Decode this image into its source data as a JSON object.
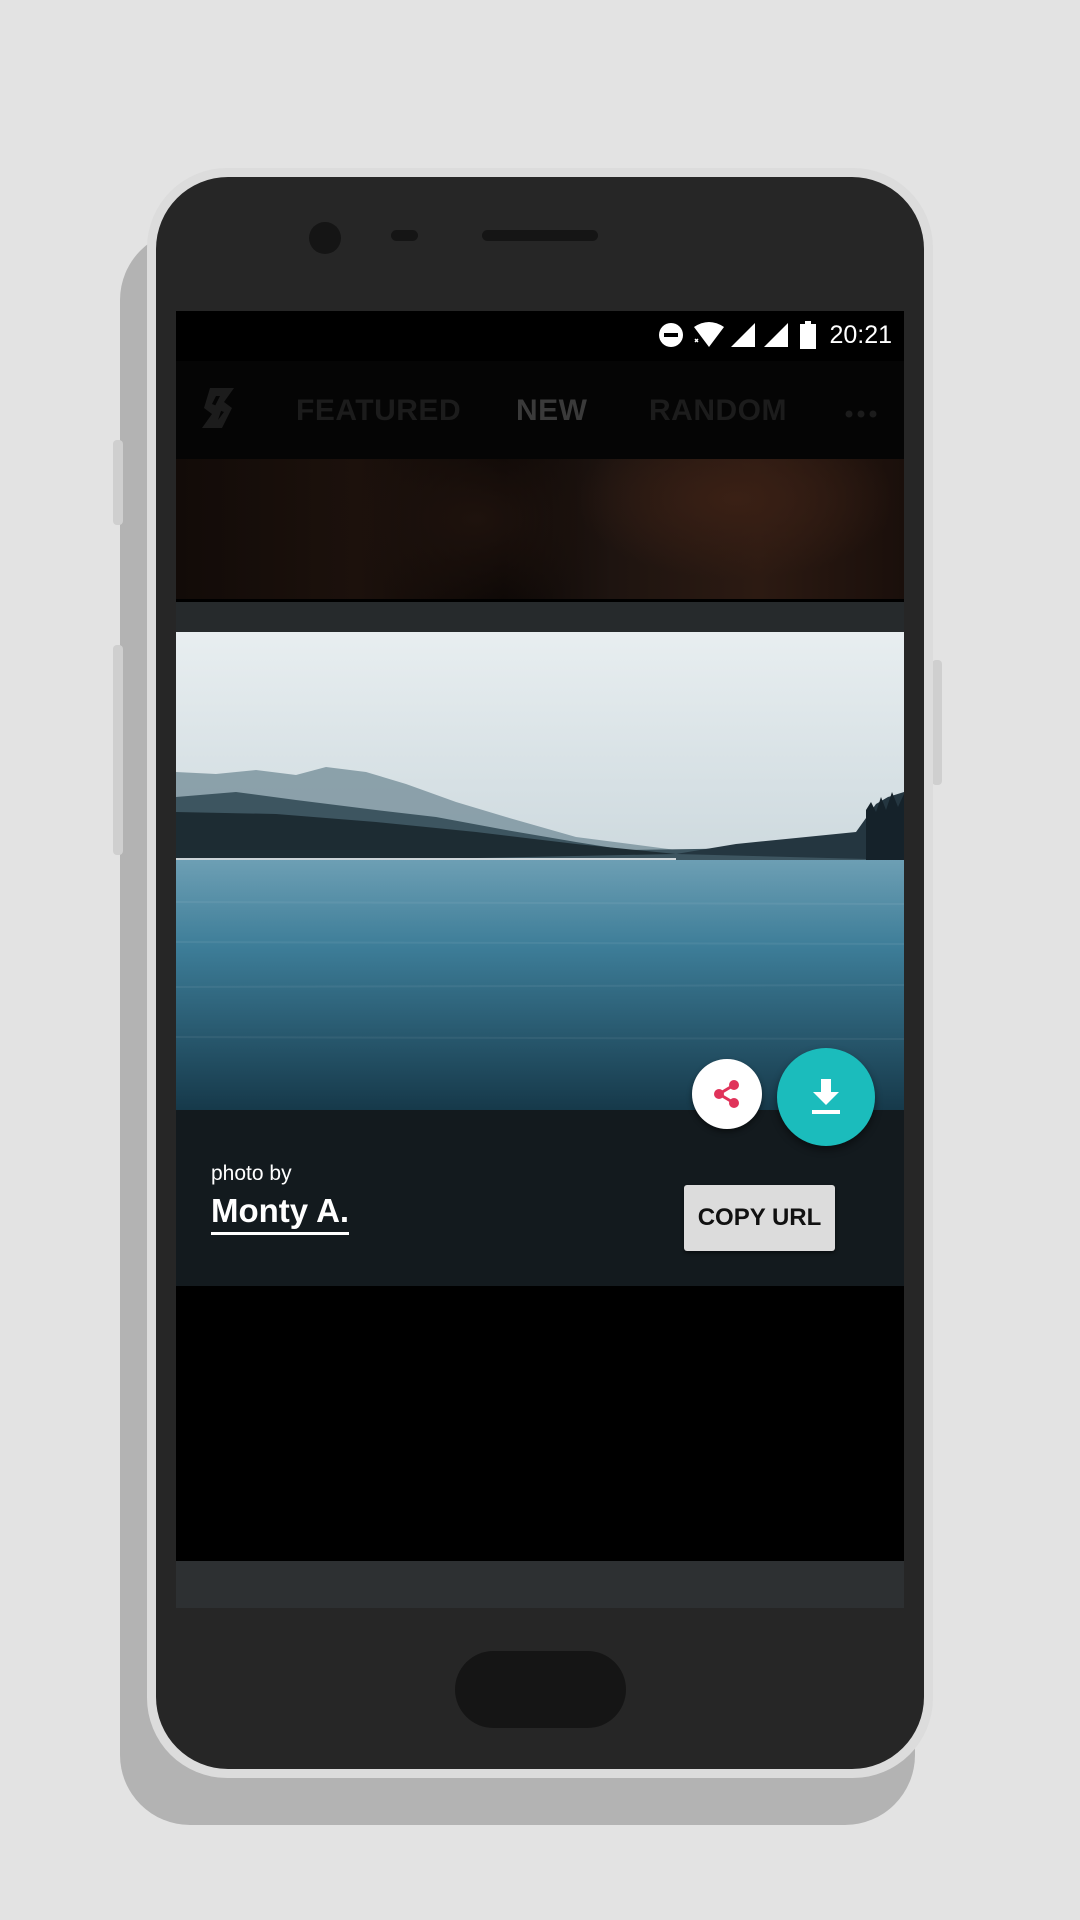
{
  "status_bar": {
    "time": "20:21",
    "icons": [
      "do-not-disturb-icon",
      "wifi-icon",
      "signal-icon",
      "signal-icon",
      "battery-icon"
    ]
  },
  "top_nav": {
    "logo_icon": "splash-logo-icon",
    "tabs": [
      {
        "label": "FEATURED",
        "active": false
      },
      {
        "label": "NEW",
        "active": true
      },
      {
        "label": "RANDOM",
        "active": false
      }
    ],
    "more_icon": "more-horizontal-icon"
  },
  "photo_card": {
    "photo_by_label": "photo by",
    "photographer": "Monty A.",
    "copy_url_label": "COPY URL",
    "share_icon": "share-icon",
    "download_icon": "download-icon"
  },
  "colors": {
    "accent": "#1bbcbc",
    "share_icon": "#e0335a",
    "card_bg": "#131a1e"
  }
}
